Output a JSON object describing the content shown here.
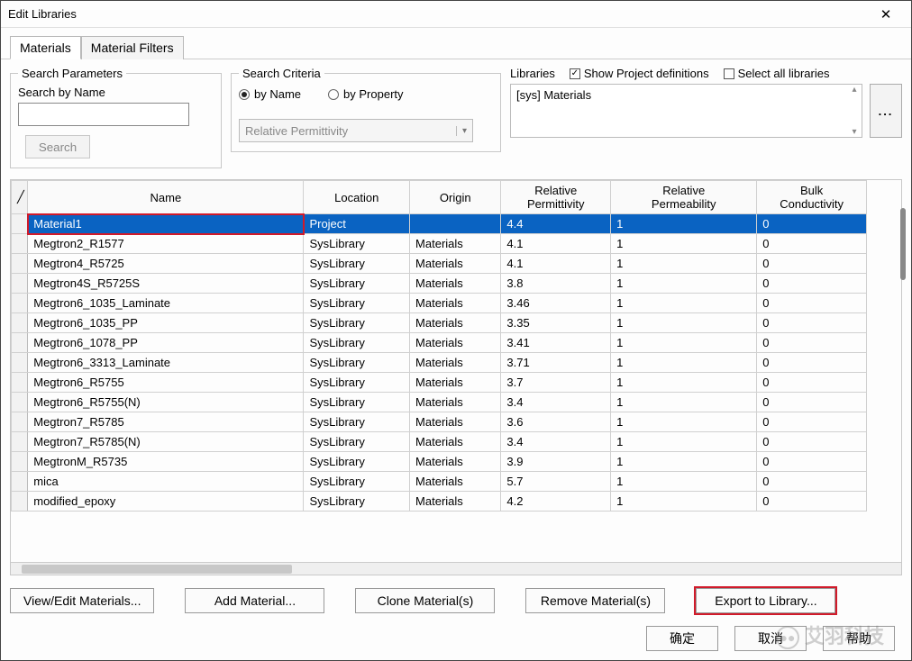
{
  "window": {
    "title": "Edit Libraries"
  },
  "tabs": [
    {
      "label": "Materials",
      "active": true
    },
    {
      "label": "Material Filters",
      "active": false
    }
  ],
  "searchParams": {
    "legend": "Search Parameters",
    "searchByNameLabel": "Search by Name",
    "searchValue": "",
    "searchButton": "Search"
  },
  "searchCriteria": {
    "legend": "Search Criteria",
    "byNameLabel": "by Name",
    "byPropertyLabel": "by Property",
    "selected": "byName",
    "propertyCombo": "Relative Permittivity"
  },
  "libraries": {
    "label": "Libraries",
    "showProjectDefs": {
      "label": "Show Project definitions",
      "checked": true
    },
    "selectAll": {
      "label": "Select all libraries",
      "checked": false
    },
    "listItems": [
      "[sys] Materials"
    ],
    "moreButton": "..."
  },
  "grid": {
    "columns": [
      "",
      "Name",
      "Location",
      "Origin",
      "Relative Permittivity",
      "Relative Permeability",
      "Bulk Conductivity"
    ],
    "rows": [
      {
        "name": "Material1",
        "location": "Project",
        "origin": "",
        "relPermittivity": "4.4",
        "relPermeability": "1",
        "bulk": "0",
        "selected": true,
        "highlightName": true
      },
      {
        "name": "Megtron2_R1577",
        "location": "SysLibrary",
        "origin": "Materials",
        "relPermittivity": "4.1",
        "relPermeability": "1",
        "bulk": "0"
      },
      {
        "name": "Megtron4_R5725",
        "location": "SysLibrary",
        "origin": "Materials",
        "relPermittivity": "4.1",
        "relPermeability": "1",
        "bulk": "0"
      },
      {
        "name": "Megtron4S_R5725S",
        "location": "SysLibrary",
        "origin": "Materials",
        "relPermittivity": "3.8",
        "relPermeability": "1",
        "bulk": "0"
      },
      {
        "name": "Megtron6_1035_Laminate",
        "location": "SysLibrary",
        "origin": "Materials",
        "relPermittivity": "3.46",
        "relPermeability": "1",
        "bulk": "0"
      },
      {
        "name": "Megtron6_1035_PP",
        "location": "SysLibrary",
        "origin": "Materials",
        "relPermittivity": "3.35",
        "relPermeability": "1",
        "bulk": "0"
      },
      {
        "name": "Megtron6_1078_PP",
        "location": "SysLibrary",
        "origin": "Materials",
        "relPermittivity": "3.41",
        "relPermeability": "1",
        "bulk": "0"
      },
      {
        "name": "Megtron6_3313_Laminate",
        "location": "SysLibrary",
        "origin": "Materials",
        "relPermittivity": "3.71",
        "relPermeability": "1",
        "bulk": "0"
      },
      {
        "name": "Megtron6_R5755",
        "location": "SysLibrary",
        "origin": "Materials",
        "relPermittivity": "3.7",
        "relPermeability": "1",
        "bulk": "0"
      },
      {
        "name": "Megtron6_R5755(N)",
        "location": "SysLibrary",
        "origin": "Materials",
        "relPermittivity": "3.4",
        "relPermeability": "1",
        "bulk": "0"
      },
      {
        "name": "Megtron7_R5785",
        "location": "SysLibrary",
        "origin": "Materials",
        "relPermittivity": "3.6",
        "relPermeability": "1",
        "bulk": "0"
      },
      {
        "name": "Megtron7_R5785(N)",
        "location": "SysLibrary",
        "origin": "Materials",
        "relPermittivity": "3.4",
        "relPermeability": "1",
        "bulk": "0"
      },
      {
        "name": "MegtronM_R5735",
        "location": "SysLibrary",
        "origin": "Materials",
        "relPermittivity": "3.9",
        "relPermeability": "1",
        "bulk": "0"
      },
      {
        "name": "mica",
        "location": "SysLibrary",
        "origin": "Materials",
        "relPermittivity": "5.7",
        "relPermeability": "1",
        "bulk": "0"
      },
      {
        "name": "modified_epoxy",
        "location": "SysLibrary",
        "origin": "Materials",
        "relPermittivity": "4.2",
        "relPermeability": "1",
        "bulk": "0"
      }
    ]
  },
  "actionButtons": {
    "viewEdit": "View/Edit Materials...",
    "add": "Add Material...",
    "clone": "Clone Material(s)",
    "remove": "Remove Material(s)",
    "export": "Export to Library..."
  },
  "dialogButtons": {
    "ok": "确定",
    "cancel": "取消",
    "help": "帮助"
  },
  "watermark": "艾羽科技"
}
